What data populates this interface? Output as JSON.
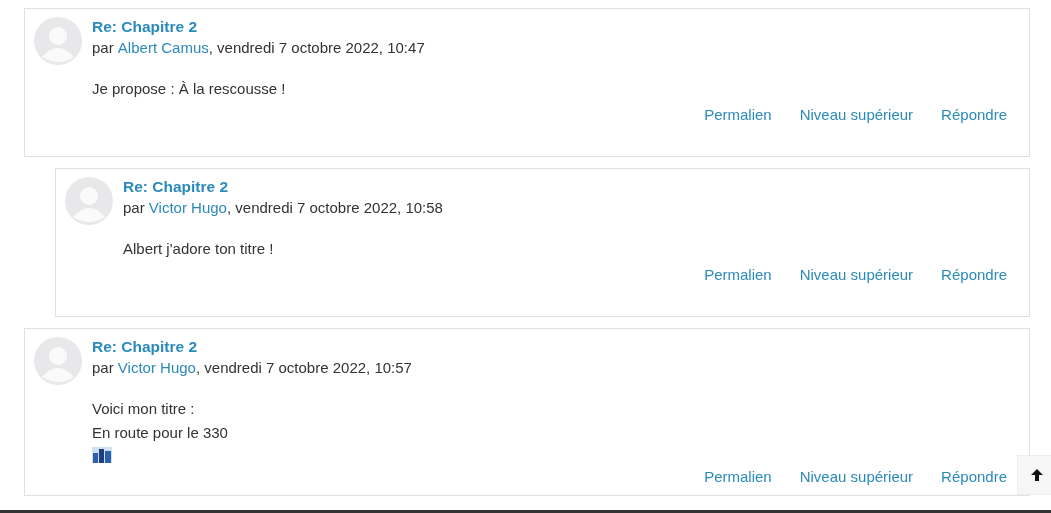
{
  "posts": [
    {
      "title": "Re: Chapitre 2",
      "by": "par",
      "author": "Albert Camus",
      "date": ", vendredi 7 octobre 2022, 10:47",
      "body": [
        {
          "kind": "text",
          "text": "Je propose : À la rescousse !"
        }
      ],
      "actions": [
        "Permalien",
        "Niveau supérieur",
        "Répondre"
      ],
      "children": [
        {
          "title": "Re: Chapitre 2",
          "by": "par",
          "author": "Victor Hugo",
          "date": ", vendredi 7 octobre 2022, 10:58",
          "body": [
            {
              "kind": "text",
              "text": "Albert j'adore ton titre !"
            }
          ],
          "actions": [
            "Permalien",
            "Niveau supérieur",
            "Répondre"
          ]
        }
      ]
    },
    {
      "title": "Re: Chapitre 2",
      "by": "par",
      "author": "Victor Hugo",
      "date": ", vendredi 7 octobre 2022, 10:57",
      "body": [
        {
          "kind": "text",
          "text": "Voici mon titre :"
        },
        {
          "kind": "text",
          "text": "En route pour le 330"
        },
        {
          "kind": "emoji"
        }
      ],
      "actions": [
        "Permalien",
        "Niveau supérieur",
        "Répondre"
      ]
    }
  ]
}
